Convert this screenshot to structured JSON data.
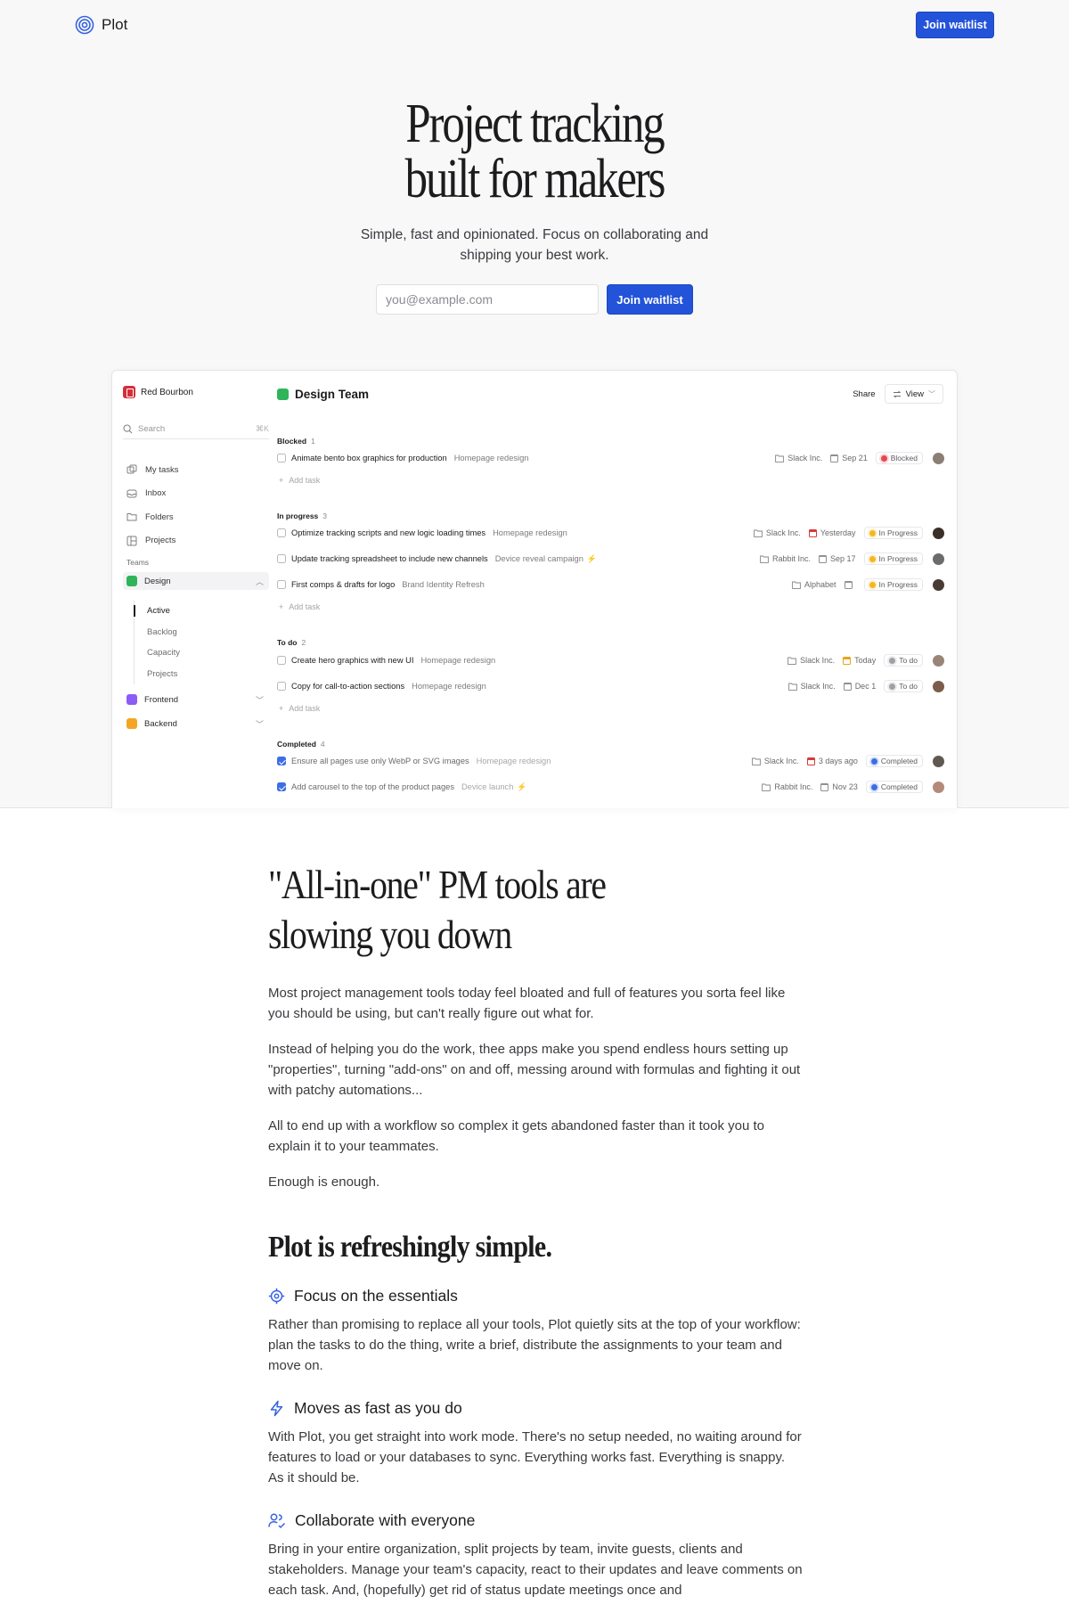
{
  "nav": {
    "brand": "Plot",
    "cta": "Join waitlist"
  },
  "hero": {
    "title_line1": "Project tracking",
    "title_line2": "built for makers",
    "subtitle": "Simple, fast and opinionated. Focus on collaborating and shipping your best work.",
    "email_placeholder": "you@example.com",
    "cta": "Join waitlist"
  },
  "app": {
    "workspace": "Red Bourbon",
    "search_placeholder": "Search",
    "search_shortcut": "⌘K",
    "nav": [
      "My tasks",
      "Inbox",
      "Folders",
      "Projects"
    ],
    "teams_label": "Teams",
    "teams": [
      {
        "name": "Design",
        "color": "#2fb45a",
        "expanded": true
      },
      {
        "name": "Frontend",
        "color": "#8b5cf6",
        "expanded": false
      },
      {
        "name": "Backend",
        "color": "#f5a524",
        "expanded": false
      }
    ],
    "design_subnav": [
      "Active",
      "Backlog",
      "Capacity",
      "Projects"
    ],
    "main_title": "Design Team",
    "share": "Share",
    "view": "View",
    "add_task": "Add task",
    "groups": [
      {
        "title": "Blocked",
        "count": "1",
        "tasks": [
          {
            "name": "Animate bento box graphics for production",
            "project": "Homepage redesign",
            "client": "Slack Inc.",
            "date": "Sep 21",
            "status": "Blocked",
            "status_color": "#e5484d",
            "done": false,
            "cal": "grey",
            "avatar_color": "#8a7f72"
          }
        ]
      },
      {
        "title": "In progress",
        "count": "3",
        "tasks": [
          {
            "name": "Optimize tracking scripts and new logic loading times",
            "project": "Homepage redesign",
            "client": "Slack Inc.",
            "date": "Yesterday",
            "status": "In Progress",
            "status_color": "#f5b71f",
            "done": false,
            "cal": "red",
            "avatar_color": "#3b2f2a"
          },
          {
            "name": "Update tracking spreadsheet to include new channels",
            "project": "Device reveal campaign",
            "client": "Rabbit Inc.",
            "date": "Sep 17",
            "status": "In Progress",
            "status_color": "#f5b71f",
            "done": false,
            "cal": "grey",
            "avatar_color": "#6b6b6b"
          },
          {
            "name": "First comps & drafts for logo",
            "project": "Brand Identity Refresh",
            "client": "Alphabet",
            "date": "",
            "status": "In Progress",
            "status_color": "#f5b71f",
            "done": false,
            "cal": "grey",
            "avatar_color": "#4a3a35"
          }
        ]
      },
      {
        "title": "To do",
        "count": "2",
        "tasks": [
          {
            "name": "Create hero graphics with new UI",
            "project": "Homepage redesign",
            "client": "Slack Inc.",
            "date": "Today",
            "status": "To do",
            "status_color": "#a0a0a6",
            "done": false,
            "cal": "yellow",
            "avatar_color": "#9a8478"
          },
          {
            "name": "Copy for call-to-action sections",
            "project": "Homepage redesign",
            "client": "Slack Inc.",
            "date": "Dec 1",
            "status": "To do",
            "status_color": "#a0a0a6",
            "done": false,
            "cal": "grey",
            "avatar_color": "#7d5c4b"
          }
        ]
      },
      {
        "title": "Completed",
        "count": "4",
        "tasks": [
          {
            "name": "Ensure all pages use only WebP or SVG images",
            "project": "Homepage redesign",
            "client": "Slack Inc.",
            "date": "3 days ago",
            "status": "Completed",
            "status_color": "#3d6ee6",
            "done": true,
            "cal": "red",
            "avatar_color": "#5e5a52"
          },
          {
            "name": "Add carousel to the top of the product pages",
            "project": "Device launch",
            "client": "Rabbit Inc.",
            "date": "Nov 23",
            "status": "Completed",
            "status_color": "#3d6ee6",
            "done": true,
            "cal": "grey",
            "avatar_color": "#b58a78"
          }
        ]
      }
    ]
  },
  "why": {
    "title_line1": "\"All-in-one\" PM tools are",
    "title_line2": "slowing you down",
    "p1": "Most project management tools today feel bloated and full of features you sorta feel like you should be using, but can't really figure out what for.",
    "p2": "Instead of helping you do the work, thee apps make you spend endless hours setting up \"properties\", turning \"add-ons\" on and off, messing around with formulas and fighting it out with patchy automations...",
    "p3": "All to end up with a workflow so complex it gets abandoned faster than it took you to explain it to your teammates.",
    "p4": "Enough is enough."
  },
  "simple": {
    "title": "Plot is refreshingly simple.",
    "features": [
      {
        "icon": "target-icon",
        "title": "Focus on the essentials",
        "body": "Rather than promising to replace all your tools, Plot quietly sits at the top of your workflow: plan the tasks to do the thing, write a brief, distribute the assignments to your team and move on."
      },
      {
        "icon": "lightning-icon",
        "title": "Moves as fast as you do",
        "body": "With Plot, you get straight into work mode. There's no setup needed, no waiting around for features to load or your databases to sync. Everything works fast. Everything is snappy. As it should be."
      },
      {
        "icon": "users-check-icon",
        "title": "Collaborate with everyone",
        "body": "Bring in your entire organization, split projects by team, invite guests, clients and stakeholders. Manage your team's capacity, react to their updates and leave comments on each task. And, (hopefully) get rid of status update meetings once and"
      }
    ]
  },
  "colors": {
    "accent": "#2353d8",
    "hero_bg": "#f8f8f9"
  }
}
